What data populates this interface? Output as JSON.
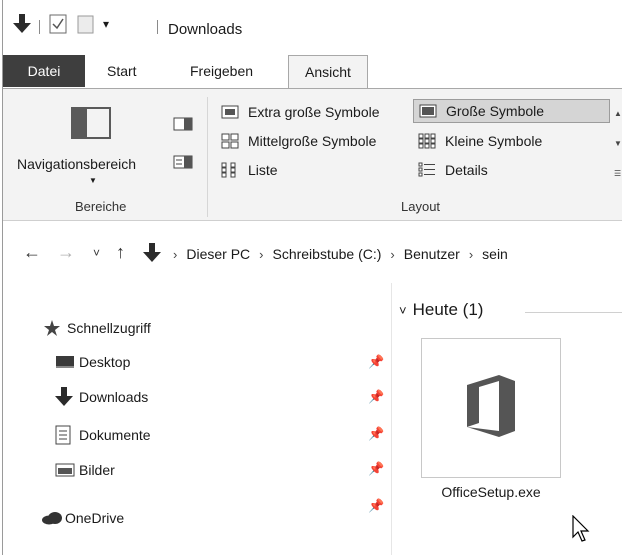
{
  "window": {
    "title": "Downloads"
  },
  "tabs": [
    {
      "label": "Datei"
    },
    {
      "label": "Start"
    },
    {
      "label": "Freigeben"
    },
    {
      "label": "Ansicht"
    }
  ],
  "ribbon": {
    "bereiche": {
      "nav_button_label": "Navigationsbereich",
      "group_label": "Bereiche"
    },
    "layout": {
      "group_label": "Layout",
      "items": [
        {
          "label": "Extra große Symbole"
        },
        {
          "label": "Große Symbole"
        },
        {
          "label": "Mittelgroße Symbole"
        },
        {
          "label": "Kleine Symbole"
        },
        {
          "label": "Liste"
        },
        {
          "label": "Details"
        }
      ],
      "selected": "Große Symbole"
    }
  },
  "address": {
    "crumbs": [
      {
        "label": "Dieser PC"
      },
      {
        "label": "Schreibstube (C:)"
      },
      {
        "label": "Benutzer"
      },
      {
        "label": "sein"
      }
    ]
  },
  "nav_pane": {
    "quick_access": "Schnellzugriff",
    "items": [
      {
        "label": "Desktop"
      },
      {
        "label": "Downloads"
      },
      {
        "label": "Dokumente"
      },
      {
        "label": "Bilder"
      }
    ],
    "onedrive": "OneDrive"
  },
  "content": {
    "group_header": "Heute (1)",
    "files": [
      {
        "name": "OfficeSetup.exe",
        "icon": "office-icon"
      }
    ]
  }
}
